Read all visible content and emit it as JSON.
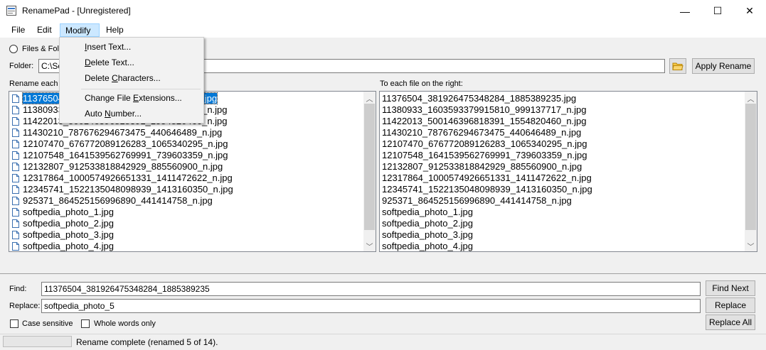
{
  "window": {
    "title": "RenamePad - [Unregistered]",
    "minimize_glyph": "—",
    "maximize_glyph": "☐",
    "close_glyph": "✕"
  },
  "menu": {
    "file": "File",
    "edit": "Edit",
    "modify": "Modify",
    "help": "Help"
  },
  "dropdown": {
    "items": [
      {
        "label": "Insert Text...",
        "mnemonic": "I"
      },
      {
        "label": "Delete Text...",
        "mnemonic": "D"
      },
      {
        "label": "Delete Characters...",
        "mnemonic": "C"
      },
      {
        "label": "Change File Extensions...",
        "mnemonic": "E"
      },
      {
        "label": "Auto Number...",
        "mnemonic": "N"
      }
    ]
  },
  "source": {
    "radio_label": "Files & Folde",
    "folder_label": "Folder:",
    "folder_value": "C:\\Sc",
    "apply_button": "Apply Rename",
    "browse_icon": "folder-icon"
  },
  "lists": {
    "left_label": "Rename each",
    "right_label": "To each file on the right:",
    "left_items": [
      "11376504_381926475348284_1885389235.jpg",
      "11380933_1603593379915810_999137717_n.jpg",
      "11422013_500146396818391_1554820460_n.jpg",
      "11430210_787676294673475_440646489_n.jpg",
      "12107470_676772089126283_1065340295_n.jpg",
      "12107548_1641539562769991_739603359_n.jpg",
      "12132807_912533818842929_885560900_n.jpg",
      "12317864_1000574926651331_1411472622_n.jpg",
      "12345741_1522135048098939_1413160350_n.jpg",
      "925371_864525156996890_441414758_n.jpg",
      "softpedia_photo_1.jpg",
      "softpedia_photo_2.jpg",
      "softpedia_photo_3.jpg",
      "softpedia_photo_4.jpg"
    ],
    "left_visible_partial": [
      {
        "prefix": "11376504",
        "suffix": ".jpg"
      },
      {
        "prefix": "1138093",
        "suffix": "_n.jpg"
      },
      {
        "prefix": "1142201",
        "suffix": "_n.jpg"
      }
    ],
    "right_items": [
      "11376504_381926475348284_1885389235.jpg",
      "11380933_1603593379915810_999137717_n.jpg",
      "11422013_500146396818391_1554820460_n.jpg",
      "11430210_787676294673475_440646489_n.jpg",
      "12107470_676772089126283_1065340295_n.jpg",
      "12107548_1641539562769991_739603359_n.jpg",
      "12132807_912533818842929_885560900_n.jpg",
      "12317864_1000574926651331_1411472622_n.jpg",
      "12345741_1522135048098939_1413160350_n.jpg",
      "925371_864525156996890_441414758_n.jpg",
      "softpedia_photo_1.jpg",
      "softpedia_photo_2.jpg",
      "softpedia_photo_3.jpg",
      "softpedia_photo_4.jpg"
    ]
  },
  "find_replace": {
    "find_label": "Find:",
    "find_value": "11376504_381926475348284_1885389235",
    "replace_label": "Replace:",
    "replace_value": "softpedia_photo_5",
    "find_next_button": "Find Next",
    "replace_button": "Replace",
    "replace_all_button": "Replace All",
    "case_sensitive_label": "Case sensitive",
    "whole_words_label": "Whole words only"
  },
  "status": {
    "message": "Rename complete (renamed 5 of 14)."
  },
  "colors": {
    "selection": "#0078d7",
    "menu_highlight": "#cce8ff"
  }
}
